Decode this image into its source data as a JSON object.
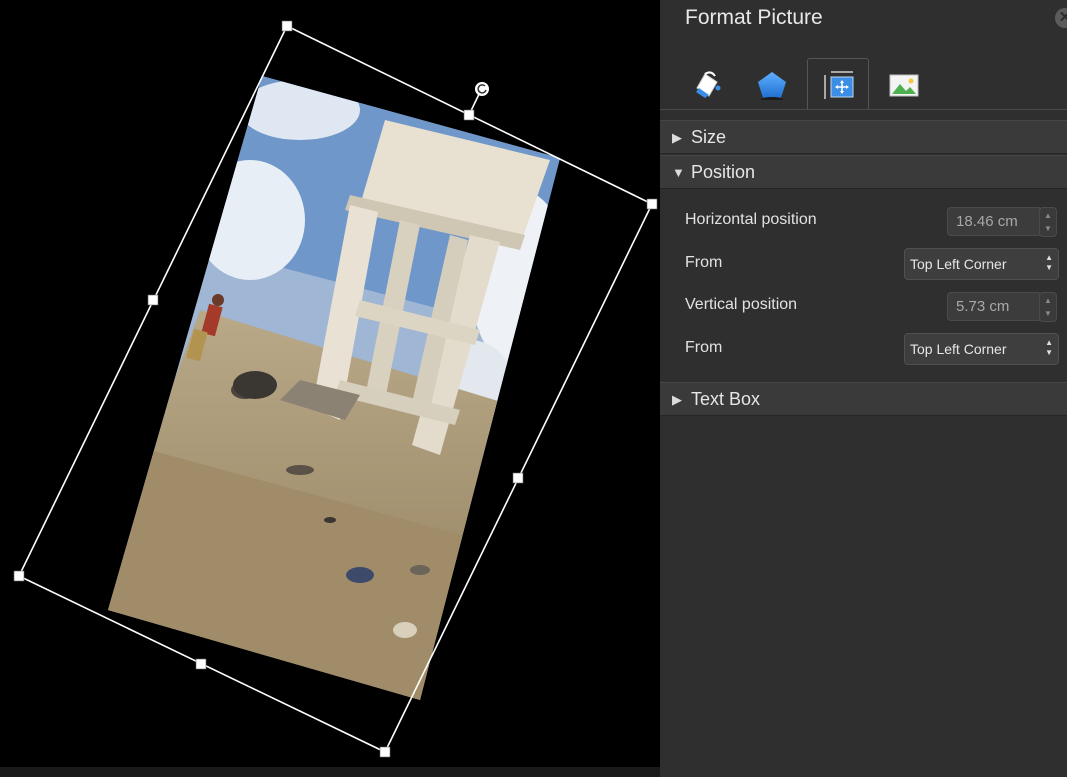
{
  "pane": {
    "title": "Format Picture",
    "close_icon": "close-icon",
    "tabs": [
      {
        "icon": "fill-line-icon",
        "active": false
      },
      {
        "icon": "effects-pentagon-icon",
        "active": false
      },
      {
        "icon": "size-properties-icon",
        "active": true
      },
      {
        "icon": "picture-icon",
        "active": false
      }
    ],
    "sections": {
      "size": {
        "label": "Size",
        "expanded": false
      },
      "position": {
        "label": "Position",
        "expanded": true,
        "horizontal_label": "Horizontal position",
        "horizontal_value": "18.46 cm",
        "from1_label": "From",
        "from1_value": "Top Left Corner",
        "vertical_label": "Vertical position",
        "vertical_value": "5.73 cm",
        "from2_label": "From",
        "from2_value": "Top Left Corner"
      },
      "textbox": {
        "label": "Text Box",
        "expanded": false
      }
    }
  },
  "colors": {
    "pane_bg": "#2f2f2f",
    "section_bg": "#3a3a3a",
    "accent_blue": "#3a8ee6"
  }
}
